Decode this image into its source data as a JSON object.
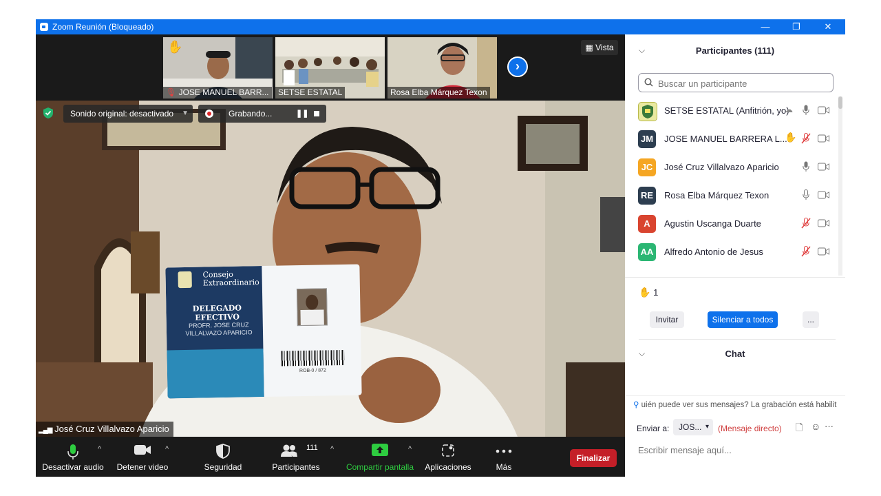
{
  "window": {
    "title": "Zoom Reunión (Bloqueado)",
    "minimize": "—",
    "restore": "❐",
    "close": "✕"
  },
  "thumbnails": [
    {
      "name": "JOSE MANUEL BARR..."
    },
    {
      "name": "SETSE ESTATAL"
    },
    {
      "name": "Rosa Elba Márquez Texon"
    }
  ],
  "vista_label": "Vista",
  "overlays": {
    "sound": "Sonido original: desactivado",
    "recording": "Grabando..."
  },
  "speaker_name": "José Cruz Villalvazo Aparicio",
  "card": {
    "header_line1": "Consejo",
    "header_line2": "Extraordinario",
    "role": "DELEGADO EFECTIVO",
    "name_line1": "PROFR. JOSE CRUZ",
    "name_line2": "VILLALVAZO APARICIO",
    "barcode_number": "ROB-0 / 872"
  },
  "toolbar": {
    "audio": "Desactivar audio",
    "video": "Detener video",
    "security": "Seguridad",
    "participants": "Participantes",
    "participants_count": "111",
    "share": "Compartir pantalla",
    "apps": "Aplicaciones",
    "more": "Más",
    "end": "Finalizar"
  },
  "panel": {
    "title": "Participantes (111)",
    "search_placeholder": "Buscar un participante",
    "participants": [
      {
        "initials": "",
        "name": "SETSE ESTATAL (Anfitrión, yo)",
        "color": "#e9e9a0"
      },
      {
        "initials": "JM",
        "name": "JOSE MANUEL BARRERA L...",
        "color": "#2d3e50"
      },
      {
        "initials": "JC",
        "name": "José Cruz Villalvazo Aparicio",
        "color": "#f5a623"
      },
      {
        "initials": "RE",
        "name": "Rosa Elba Márquez Texon",
        "color": "#2d3e50"
      },
      {
        "initials": "A",
        "name": "Agustin Uscanga Duarte",
        "color": "#d9442f"
      },
      {
        "initials": "AA",
        "name": "Alfredo Antonio de Jesus",
        "color": "#2bb673"
      }
    ],
    "raised_hands": "1",
    "invite": "Invitar",
    "mute_all": "Silenciar a todos",
    "more": "...",
    "chat_title": "Chat",
    "chat_notice": "uién puede ver sus mensajes? La grabación está habilit",
    "send_to_label": "Enviar a:",
    "send_to_value": "JOS...",
    "direct_message": "(Mensaje directo)",
    "chat_placeholder": "Escribir mensaje aquí..."
  }
}
